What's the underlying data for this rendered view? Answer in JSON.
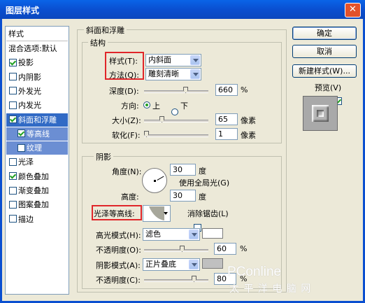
{
  "window": {
    "title": "图层样式",
    "close_symbol": "✕"
  },
  "sidebar": {
    "header_label": "样式",
    "items": [
      {
        "label": "混合选项:默认",
        "checkbox": false,
        "checked": false,
        "state": "normal"
      },
      {
        "label": "投影",
        "checkbox": true,
        "checked": true,
        "state": "normal"
      },
      {
        "label": "内阴影",
        "checkbox": true,
        "checked": false,
        "state": "normal"
      },
      {
        "label": "外发光",
        "checkbox": true,
        "checked": false,
        "state": "normal"
      },
      {
        "label": "内发光",
        "checkbox": true,
        "checked": false,
        "state": "normal"
      },
      {
        "label": "斜面和浮雕",
        "checkbox": true,
        "checked": true,
        "state": "selected"
      },
      {
        "label": "等高线",
        "checkbox": true,
        "checked": true,
        "state": "sub"
      },
      {
        "label": "纹理",
        "checkbox": true,
        "checked": false,
        "state": "sub"
      },
      {
        "label": "光泽",
        "checkbox": true,
        "checked": false,
        "state": "normal"
      },
      {
        "label": "颜色叠加",
        "checkbox": true,
        "checked": true,
        "state": "normal"
      },
      {
        "label": "渐变叠加",
        "checkbox": true,
        "checked": false,
        "state": "normal"
      },
      {
        "label": "图案叠加",
        "checkbox": true,
        "checked": false,
        "state": "normal"
      },
      {
        "label": "描边",
        "checkbox": true,
        "checked": false,
        "state": "normal"
      }
    ]
  },
  "bevel": {
    "section_title": "斜面和浮雕",
    "structure": {
      "title": "结构",
      "style_label": "样式(T):",
      "style_value": "内斜面",
      "method_label": "方法(Q):",
      "method_value": "雕刻清晰",
      "depth_label": "深度(D):",
      "depth_value": "660",
      "depth_unit": "%",
      "depth_level": 0.66,
      "direction_label": "方向:",
      "direction_up": "上",
      "direction_down": "下",
      "direction_selected": "up",
      "size_label": "大小(Z):",
      "size_value": "65",
      "size_unit": "像素",
      "size_level": 0.26,
      "soften_label": "软化(F):",
      "soften_value": "1",
      "soften_unit": "像素",
      "soften_level": 0.0
    },
    "shading": {
      "title": "阴影",
      "angle_label": "角度(N):",
      "angle_value": "30",
      "angle_unit": "度",
      "global_light_label": "使用全局光(G)",
      "global_light_checked": true,
      "altitude_label": "高度:",
      "altitude_value": "30",
      "altitude_unit": "度",
      "gloss_contour_label": "光泽等高线:",
      "anti_alias_label": "消除锯齿(L)",
      "anti_alias_checked": false,
      "highlight_mode_label": "高光模式(H):",
      "highlight_mode_value": "滤色",
      "highlight_color": "#ffffff",
      "highlight_opacity_label": "不透明度(O):",
      "highlight_opacity_value": "60",
      "highlight_opacity_unit": "%",
      "highlight_opacity_level": 0.6,
      "shadow_mode_label": "阴影模式(A):",
      "shadow_mode_value": "正片叠底",
      "shadow_color": "#c0c0c0",
      "shadow_opacity_label": "不透明度(C):",
      "shadow_opacity_value": "80",
      "shadow_opacity_unit": "%",
      "shadow_opacity_level": 0.8
    }
  },
  "buttons": {
    "ok": "确定",
    "cancel": "取消",
    "new_style": "新建样式(W)...",
    "preview_label": "预览(V)",
    "preview_checked": true
  },
  "watermark": {
    "line1": "PConline",
    "line2": "太 平 洋 电 脑 网"
  }
}
